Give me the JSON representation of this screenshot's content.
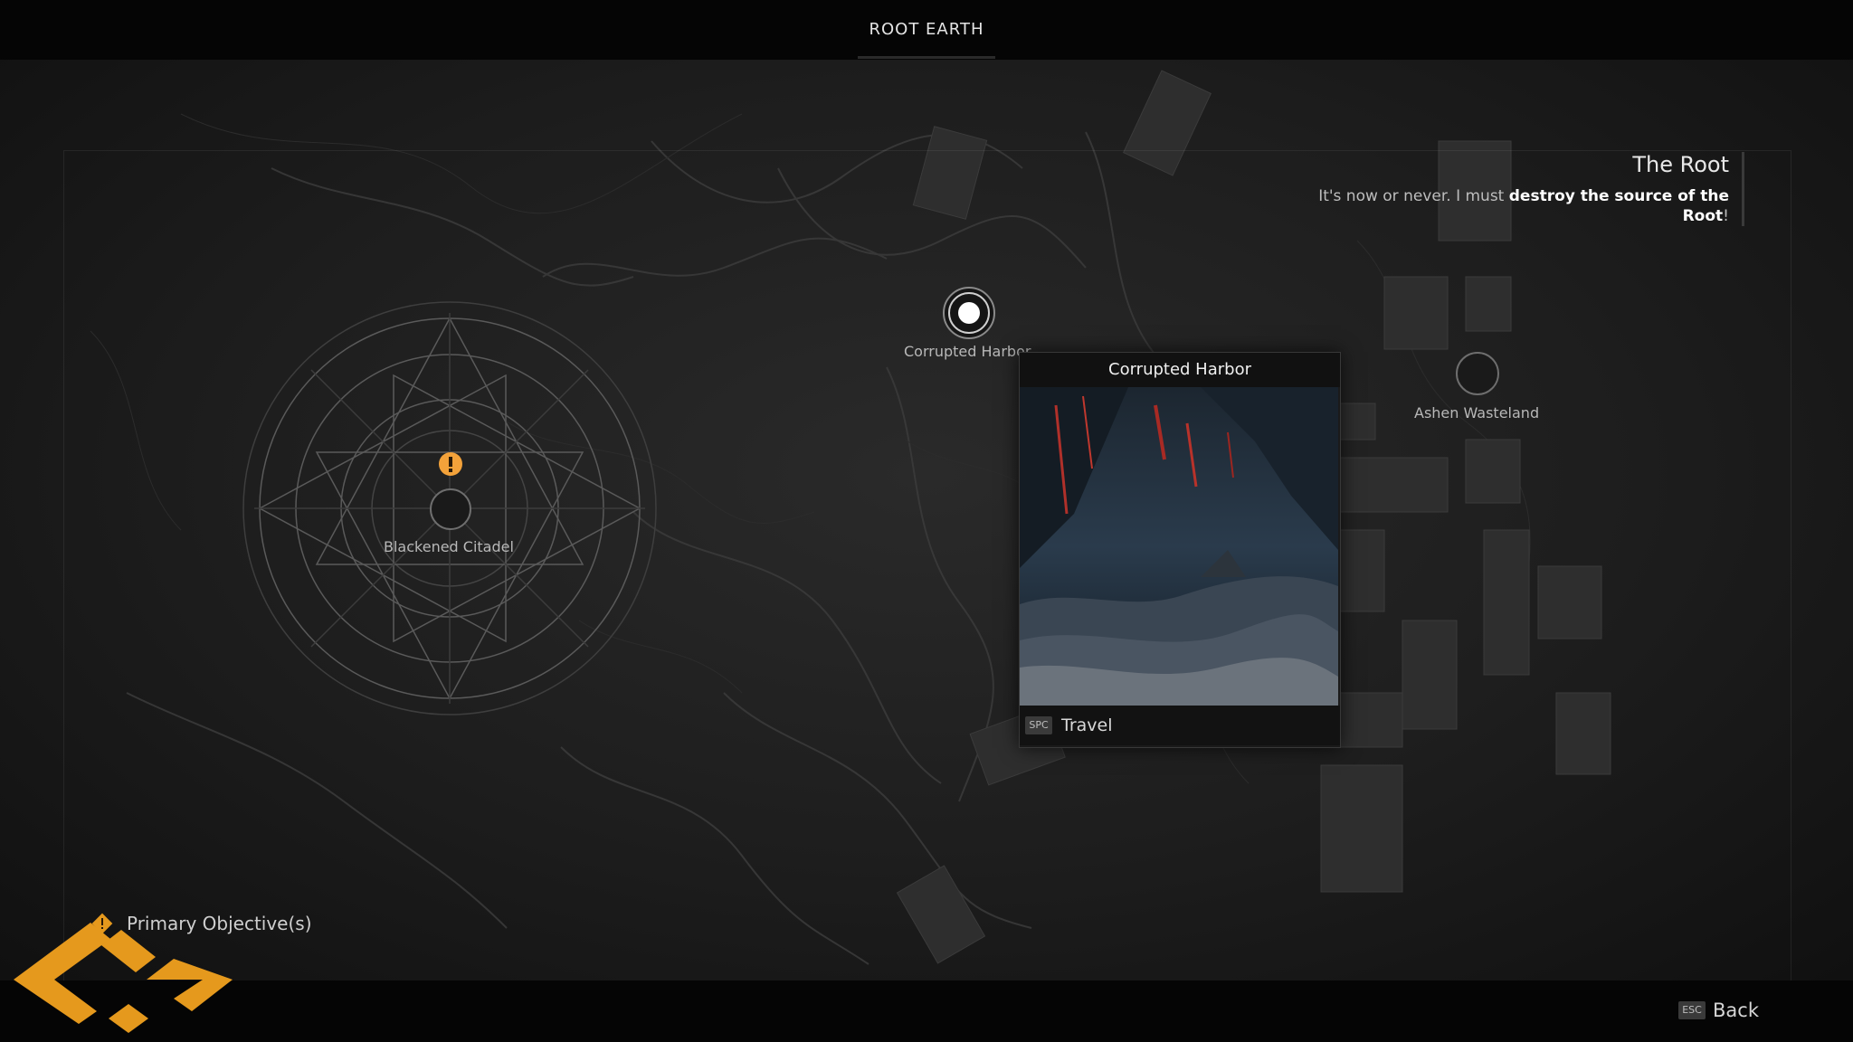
{
  "header": {
    "region_title": "ROOT EARTH"
  },
  "objective": {
    "title": "The Root",
    "desc_plain": "It's now or never. I must ",
    "desc_bold": "destroy the source of the Root",
    "desc_end": "!"
  },
  "locations": [
    {
      "name": "Blackened Citadel",
      "state": "objective"
    },
    {
      "name": "Corrupted Harbor",
      "state": "selected"
    },
    {
      "name": "Ashen Wasteland",
      "state": "locked"
    }
  ],
  "popup": {
    "title": "Corrupted Harbor",
    "action_key": "SPC",
    "action_label": "Travel"
  },
  "legend": {
    "label": "Primary Objective(s)",
    "icon": "objective-diamond-icon"
  },
  "footer": {
    "back_key": "ESC",
    "back_label": "Back"
  },
  "colors": {
    "objective": "#f3a23a",
    "logo": "#e5991d",
    "background": "#1d1d1d"
  }
}
